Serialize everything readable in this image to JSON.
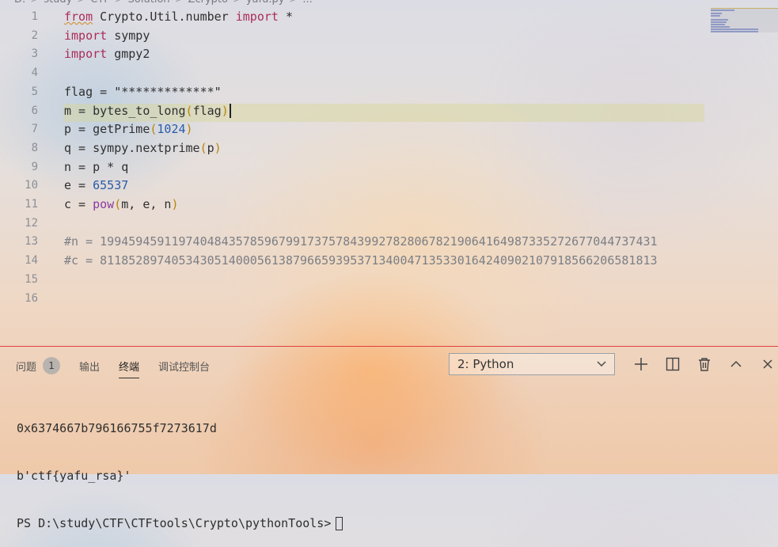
{
  "breadcrumb": [
    "D:",
    "study",
    "CTF",
    "Solution",
    "Zcrypto",
    "yafu.py",
    "..."
  ],
  "editor": {
    "lines": [
      {
        "n": "1",
        "tokens": [
          {
            "t": "from",
            "c": "imp"
          },
          {
            "t": " Crypto.Util.number ",
            "c": ""
          },
          {
            "t": "import",
            "c": "imp"
          },
          {
            "t": " *",
            "c": ""
          }
        ]
      },
      {
        "n": "2",
        "tokens": [
          {
            "t": "import",
            "c": "imp"
          },
          {
            "t": " sympy",
            "c": ""
          }
        ]
      },
      {
        "n": "3",
        "tokens": [
          {
            "t": "import",
            "c": "imp"
          },
          {
            "t": " gmpy2",
            "c": ""
          }
        ]
      },
      {
        "n": "4",
        "tokens": []
      },
      {
        "n": "5",
        "tokens": [
          {
            "t": "flag = ",
            "c": ""
          },
          {
            "t": "\"*************\"",
            "c": ""
          }
        ]
      },
      {
        "n": "6",
        "tokens": [
          {
            "t": "m = bytes_to_long",
            "c": ""
          },
          {
            "t": "(",
            "c": "paren"
          },
          {
            "t": "flag",
            "c": ""
          },
          {
            "t": ")",
            "c": "paren"
          }
        ]
      },
      {
        "n": "7",
        "tokens": [
          {
            "t": "p = getPrime",
            "c": ""
          },
          {
            "t": "(",
            "c": "paren"
          },
          {
            "t": "1024",
            "c": "num"
          },
          {
            "t": ")",
            "c": "paren"
          }
        ]
      },
      {
        "n": "8",
        "tokens": [
          {
            "t": "q = sympy.nextprime",
            "c": ""
          },
          {
            "t": "(",
            "c": "paren"
          },
          {
            "t": "p",
            "c": ""
          },
          {
            "t": ")",
            "c": "paren"
          }
        ]
      },
      {
        "n": "9",
        "tokens": [
          {
            "t": "n = p * q",
            "c": ""
          }
        ]
      },
      {
        "n": "10",
        "tokens": [
          {
            "t": "e = ",
            "c": ""
          },
          {
            "t": "65537",
            "c": "num"
          }
        ]
      },
      {
        "n": "11",
        "tokens": [
          {
            "t": "c = ",
            "c": ""
          },
          {
            "t": "pow",
            "c": "fn"
          },
          {
            "t": "(",
            "c": "paren"
          },
          {
            "t": "m, e, n",
            "c": ""
          },
          {
            "t": ")",
            "c": "paren"
          }
        ]
      },
      {
        "n": "12",
        "tokens": []
      },
      {
        "n": "13",
        "tokens": [
          {
            "t": "#n = 199459459119740484357859679917375784399278280678219064164987335272677044737431",
            "c": "cmt"
          }
        ]
      },
      {
        "n": "14",
        "tokens": [
          {
            "t": "#c = 811852897405343051400056138796659395371340047135330164240902107918566206581813",
            "c": "cmt"
          }
        ]
      },
      {
        "n": "15",
        "tokens": []
      },
      {
        "n": "16",
        "tokens": []
      }
    ]
  },
  "panel": {
    "tabs": [
      {
        "label": "问题",
        "badge": "1",
        "active": false
      },
      {
        "label": "输出",
        "active": false
      },
      {
        "label": "终端",
        "active": true
      },
      {
        "label": "调试控制台",
        "active": false
      }
    ],
    "terminal_select": "2: Python",
    "actions": [
      "plus-icon",
      "split-icon",
      "trash-icon",
      "chevron-up-icon",
      "close-icon"
    ]
  },
  "terminal": {
    "lines": [
      "0x6374667b796166755f7273617d",
      "b'ctf{yafu_rsa}'"
    ],
    "prompt": "PS D:\\study\\CTF\\CTFtools\\Crypto\\pythonTools>"
  }
}
